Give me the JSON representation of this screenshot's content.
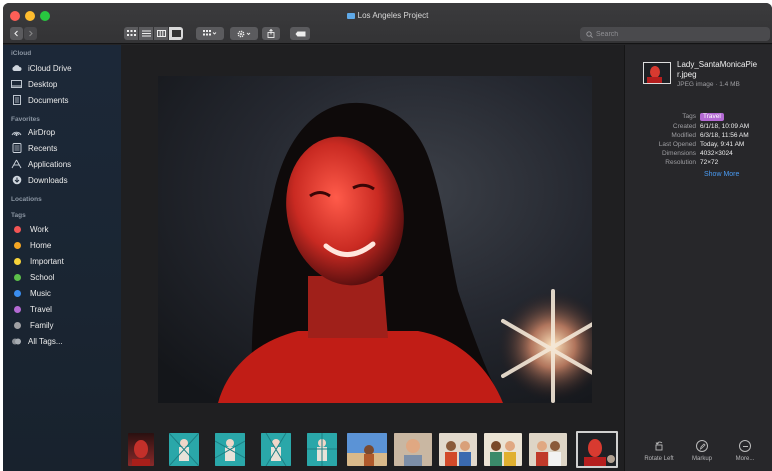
{
  "window": {
    "title": "Los Angeles Project"
  },
  "toolbar": {
    "back_icon": "chevron-left-icon",
    "forward_icon": "chevron-right-icon",
    "view_modes": [
      "icon-view-icon",
      "list-view-icon",
      "column-view-icon",
      "gallery-view-icon"
    ],
    "active_view": "gallery-view-icon",
    "group_icon": "group-grid-icon",
    "action_icon": "gear-icon",
    "share_icon": "share-icon",
    "tag_icon": "tag-icon",
    "search_placeholder": "Search"
  },
  "sidebar": {
    "sections": [
      {
        "header": "iCloud",
        "items": [
          {
            "label": "iCloud Drive",
            "icon": "cloud-icon"
          },
          {
            "label": "Desktop",
            "icon": "desktop-icon"
          },
          {
            "label": "Documents",
            "icon": "document-icon"
          }
        ]
      },
      {
        "header": "Favorites",
        "items": [
          {
            "label": "AirDrop",
            "icon": "airdrop-icon"
          },
          {
            "label": "Recents",
            "icon": "recents-icon"
          },
          {
            "label": "Applications",
            "icon": "applications-icon"
          },
          {
            "label": "Downloads",
            "icon": "downloads-icon"
          }
        ]
      },
      {
        "header": "Locations",
        "items": []
      },
      {
        "header": "Tags",
        "items": [
          {
            "label": "Work",
            "color": "#f25555"
          },
          {
            "label": "Home",
            "color": "#f5a623"
          },
          {
            "label": "Important",
            "color": "#f7d33a"
          },
          {
            "label": "School",
            "color": "#5cc04a"
          },
          {
            "label": "Music",
            "color": "#3a8ef0"
          },
          {
            "label": "Travel",
            "color": "#b46ad4"
          },
          {
            "label": "Family",
            "color": "#a0a0a4"
          },
          {
            "label": "All Tags...",
            "icon": "all-tags-icon"
          }
        ]
      }
    ]
  },
  "inspector": {
    "file_name": "Lady_SantaMonicaPier.jpeg",
    "file_name_line1": "Lady_SantaMonicaPie",
    "file_name_line2": "r.jpeg",
    "file_kind": "JPEG image · 1.4 MB",
    "tags_label": "Tags",
    "tag_value": "Travel",
    "tag_color": "#b46ad4",
    "metadata": [
      {
        "key": "Created",
        "value": "6/1/18, 10:09 AM"
      },
      {
        "key": "Modified",
        "value": "6/3/18, 11:56 AM"
      },
      {
        "key": "Last Opened",
        "value": "Today, 9:41 AM"
      },
      {
        "key": "Dimensions",
        "value": "4032×3024"
      },
      {
        "key": "Resolution",
        "value": "72×72"
      }
    ],
    "show_more": "Show More"
  },
  "quick_actions": [
    {
      "label": "Rotate Left",
      "icon": "rotate-left-icon"
    },
    {
      "label": "Markup",
      "icon": "markup-icon"
    },
    {
      "label": "More...",
      "icon": "more-icon"
    }
  ],
  "gallery": {
    "selected_index": 10,
    "thumbnails": [
      {
        "name": "portrait-red",
        "tone": "#8a2a2a"
      },
      {
        "name": "teal-pattern-1",
        "tone": "#2aa7a9"
      },
      {
        "name": "teal-pattern-2",
        "tone": "#2aa7a9"
      },
      {
        "name": "teal-pattern-3",
        "tone": "#2aa7a9"
      },
      {
        "name": "teal-pattern-4",
        "tone": "#2aa7a9"
      },
      {
        "name": "beach-sky",
        "tone": "#4a7fc0"
      },
      {
        "name": "man-portrait",
        "tone": "#b08a70"
      },
      {
        "name": "group-1",
        "tone": "#c0836a"
      },
      {
        "name": "group-2",
        "tone": "#d1a07a"
      },
      {
        "name": "group-3",
        "tone": "#c58f6c"
      },
      {
        "name": "lady-red-selected",
        "tone": "#b51e1e"
      }
    ]
  },
  "colors": {
    "sidebar_bg": "#1c2838",
    "window_bg": "#242426",
    "accent_link": "#4a9bf2"
  }
}
